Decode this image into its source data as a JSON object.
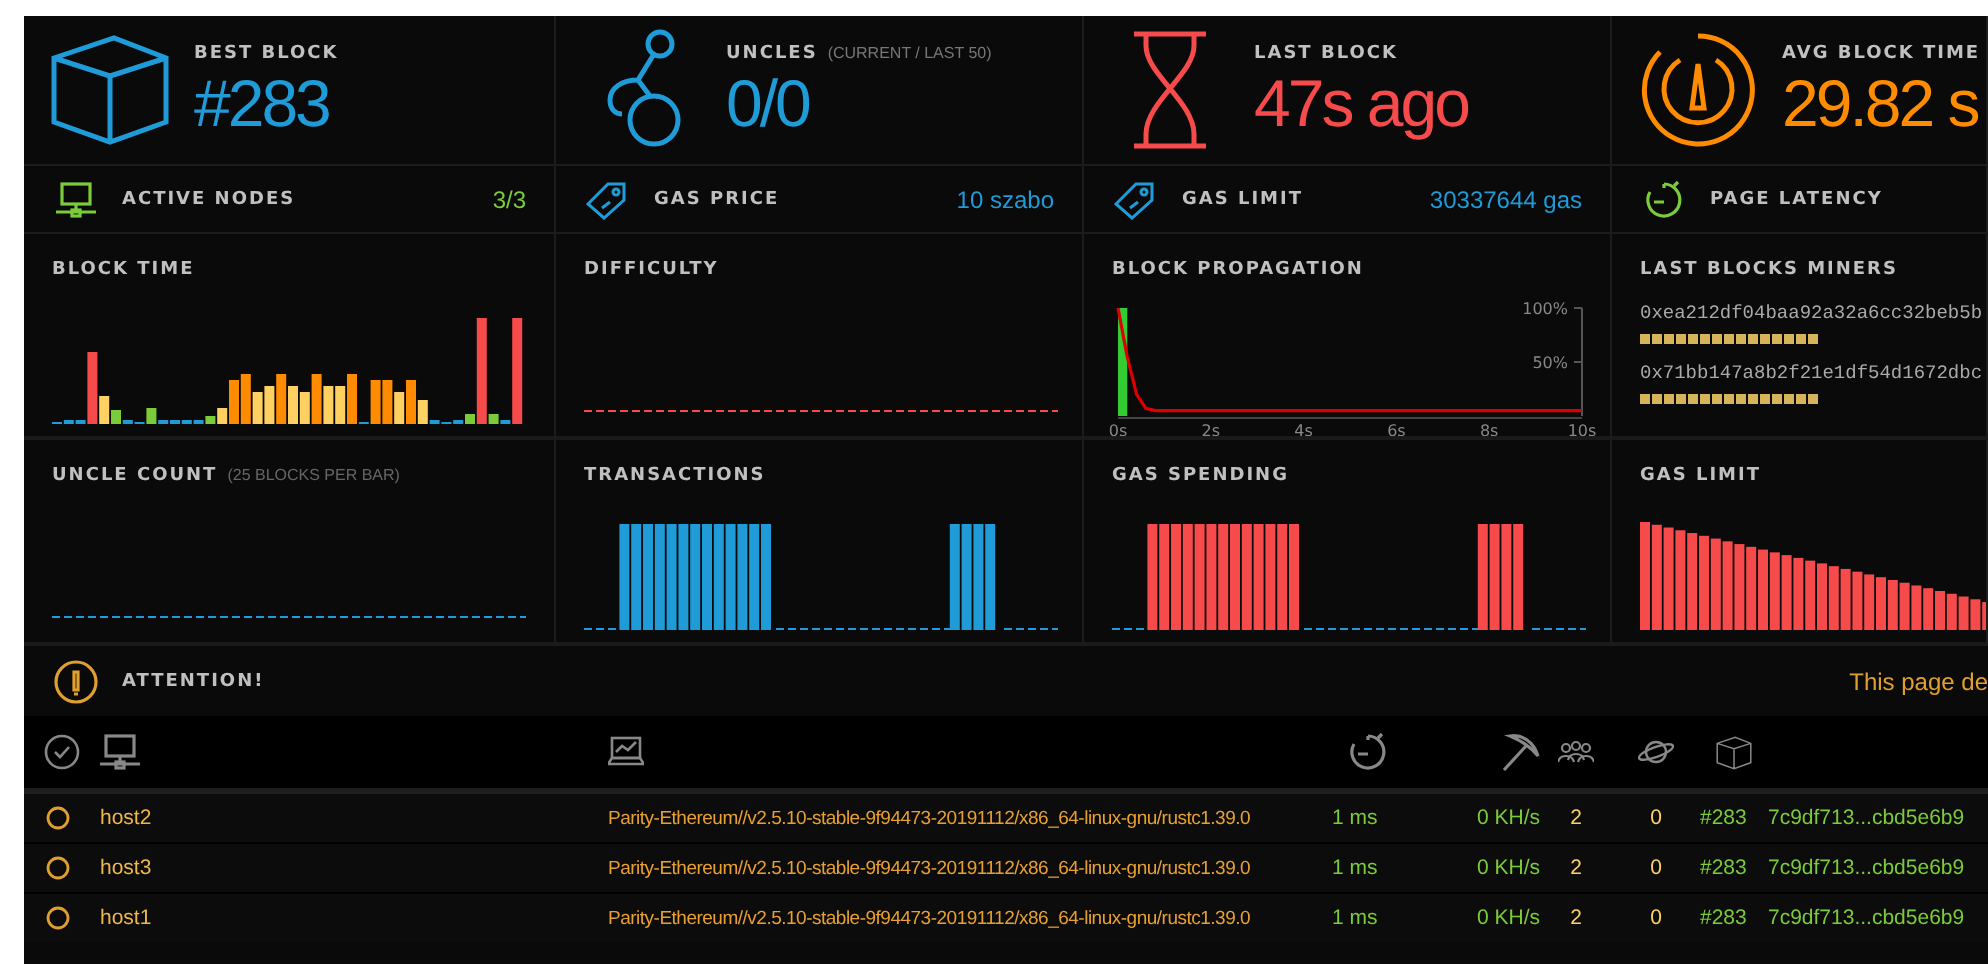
{
  "stats": [
    {
      "label": "BEST BLOCK",
      "value": "#283",
      "color": "#1f9bd8"
    },
    {
      "label": "UNCLES",
      "note": "(CURRENT / LAST 50)",
      "value": "0/0",
      "color": "#1f9bd8"
    },
    {
      "label": "LAST BLOCK",
      "value": "47s ago",
      "color": "#f74b4b"
    },
    {
      "label": "AVG BLOCK TIME",
      "value": "29.82 s",
      "color": "#ff8c00"
    }
  ],
  "mini_stats": [
    {
      "label": "ACTIVE NODES",
      "value": "3/3",
      "color": "#7bcc3a"
    },
    {
      "label": "GAS PRICE",
      "value": "10 szabo",
      "color": "#1f9bd8"
    },
    {
      "label": "GAS LIMIT",
      "value": "30337644 gas",
      "color": "#1f9bd8"
    },
    {
      "label": "PAGE LATENCY",
      "color": "#7bcc3a"
    }
  ],
  "panels": [
    {
      "kind": "block-time",
      "title": "BLOCK TIME"
    },
    {
      "kind": "difficulty",
      "title": "DIFFICULTY"
    },
    {
      "kind": "propagation",
      "title": "BLOCK PROPAGATION",
      "chart_data": {
        "type": "line",
        "x": [
          0,
          0.2,
          0.4,
          0.6,
          0.8,
          1,
          10
        ],
        "series": [
          {
            "color": "#dd0000",
            "values": [
              100,
              55,
              20,
              7,
              5,
              5,
              5
            ]
          }
        ],
        "bands": [
          {
            "axis": "x",
            "from": 0,
            "to": 0.2,
            "color": "#33cc33"
          }
        ],
        "xlim": [
          0,
          10
        ],
        "ylim": [
          0,
          100
        ],
        "xticks": [
          {
            "value": 0,
            "label": "0s"
          },
          {
            "value": 2,
            "label": "2s"
          },
          {
            "value": 4,
            "label": "4s"
          },
          {
            "value": 6,
            "label": "6s"
          },
          {
            "value": 8,
            "label": "8s"
          },
          {
            "value": 10,
            "label": "10s"
          }
        ],
        "yticks": [
          {
            "value": 50,
            "label": "50%"
          },
          {
            "value": 100,
            "label": "100%"
          }
        ]
      }
    },
    {
      "kind": "miners",
      "title": "LAST BLOCKS MINERS",
      "miners": [
        "0xea212df04baa92a32a6cc32beb5b",
        "0x71bb147a8b2f21e1df54d1672dbc"
      ]
    },
    {
      "kind": "uncle-count",
      "title": "UNCLE COUNT",
      "note": "(25 BLOCKS PER BAR)"
    },
    {
      "kind": "transactions",
      "title": "TRANSACTIONS"
    },
    {
      "kind": "gas-spending",
      "title": "GAS SPENDING"
    },
    {
      "kind": "gas-limit",
      "title": "GAS LIMIT"
    }
  ],
  "attention": {
    "title": "ATTENTION!",
    "message": "This page de"
  },
  "nodes": [
    {
      "name": "host2",
      "client": "Parity-Ethereum//v2.5.10-stable-9f94473-20191112/x86_64-linux-gnu/rustc1.39.0",
      "latency": "1 ms",
      "hashrate": "0 KH/s",
      "peers": "2",
      "pending": "0",
      "block": "#283",
      "hash": "7c9df713...cbd5e6b9"
    },
    {
      "name": "host3",
      "client": "Parity-Ethereum//v2.5.10-stable-9f94473-20191112/x86_64-linux-gnu/rustc1.39.0",
      "latency": "1 ms",
      "hashrate": "0 KH/s",
      "peers": "2",
      "pending": "0",
      "block": "#283",
      "hash": "7c9df713...cbd5e6b9"
    },
    {
      "name": "host1",
      "client": "Parity-Ethereum//v2.5.10-stable-9f94473-20191112/x86_64-linux-gnu/rustc1.39.0",
      "latency": "1 ms",
      "hashrate": "0 KH/s",
      "peers": "2",
      "pending": "0",
      "block": "#283",
      "hash": "7c9df713...cbd5e6b9"
    }
  ]
}
